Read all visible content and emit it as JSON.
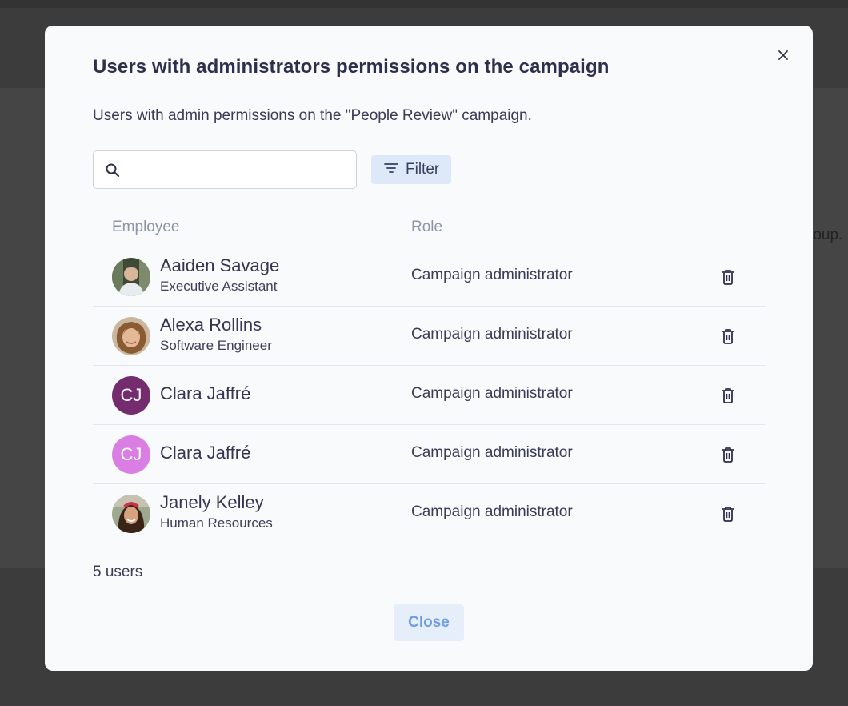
{
  "background": {
    "partial_text": "roup."
  },
  "modal": {
    "title": "Users with administrators permissions on the campaign",
    "subtitle": "Users with admin permissions on the \"People Review\" campaign.",
    "close_icon": "close-icon",
    "search": {
      "placeholder": "",
      "value": "",
      "icon": "search-icon"
    },
    "filter": {
      "label": "Filter",
      "icon": "filter-icon"
    },
    "table": {
      "headers": {
        "employee": "Employee",
        "role": "Role"
      },
      "rows": [
        {
          "name": "Aaiden Savage",
          "job": "Executive Assistant",
          "role": "Campaign administrator",
          "avatar": {
            "type": "photo"
          }
        },
        {
          "name": "Alexa Rollins",
          "job": "Software Engineer",
          "role": "Campaign administrator",
          "avatar": {
            "type": "photo"
          }
        },
        {
          "name": "Clara Jaffré",
          "job": "",
          "role": "Campaign administrator",
          "avatar": {
            "type": "initials",
            "initials": "CJ",
            "color": "#742c6f"
          }
        },
        {
          "name": "Clara Jaffré",
          "job": "",
          "role": "Campaign administrator",
          "avatar": {
            "type": "initials",
            "initials": "CJ",
            "color": "#d97fe3"
          }
        },
        {
          "name": "Janely Kelley",
          "job": "Human Resources",
          "role": "Campaign administrator",
          "avatar": {
            "type": "photo"
          }
        }
      ]
    },
    "count_label": "5 users",
    "close_button": "Close"
  },
  "colors": {
    "accent": "#6f9fe0",
    "filter_bg": "#dde9f8",
    "modal_bg": "#f8fafc"
  }
}
